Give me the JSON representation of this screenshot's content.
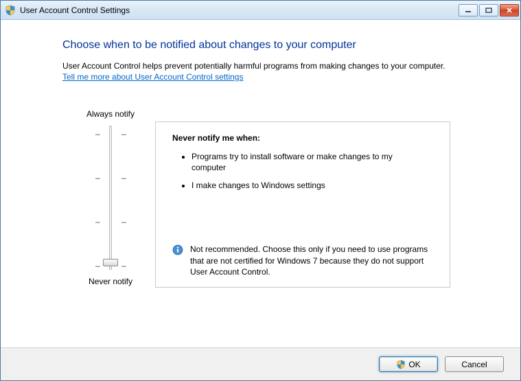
{
  "window": {
    "title": "User Account Control Settings"
  },
  "main": {
    "heading": "Choose when to be notified about changes to your computer",
    "description": "User Account Control helps prevent potentially harmful programs from making changes to your computer.",
    "link": "Tell me more about User Account Control settings"
  },
  "slider": {
    "top_label": "Always notify",
    "bottom_label": "Never notify",
    "levels": 4,
    "current_level": 0
  },
  "panel": {
    "heading": "Never notify me when:",
    "bullets": [
      "Programs try to install software or make changes to my computer",
      "I make changes to Windows settings"
    ],
    "recommendation": "Not recommended. Choose this only if you need to use programs that are not certified for Windows 7 because they do not support User Account Control."
  },
  "footer": {
    "ok_label": "OK",
    "cancel_label": "Cancel"
  }
}
